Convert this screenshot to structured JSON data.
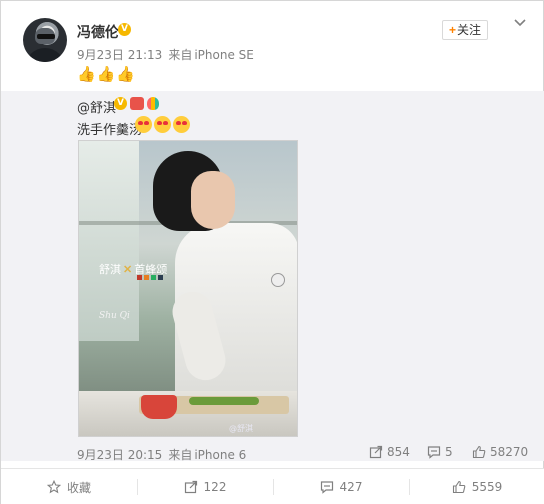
{
  "post": {
    "username": "冯德伦",
    "verified_badge": "V",
    "time": "9月23日 21:13",
    "source_prefix": "来自",
    "source": "iPhone SE",
    "text": "👍👍👍",
    "follow_label": "关注"
  },
  "repost": {
    "author": "@舒淇",
    "verified_badge": "V",
    "text": "洗手作羹汤",
    "image": {
      "logo_left": "舒淇",
      "logo_right": "首蜂颂",
      "signature": "Shu Qi",
      "watermark": "@舒淇"
    },
    "time": "9月23日 20:15",
    "source_prefix": "来自",
    "source": "iPhone 6",
    "stats": {
      "reposts": "854",
      "comments": "5",
      "likes": "58270"
    }
  },
  "footer": {
    "favorite_label": "收藏",
    "reposts": "122",
    "comments": "427",
    "likes": "5559"
  },
  "colors": {
    "accent_orange": "#ff8200",
    "badge_gold": "#f6b800",
    "text_gray": "#808080",
    "repost_bg": "#f2f2f5"
  }
}
